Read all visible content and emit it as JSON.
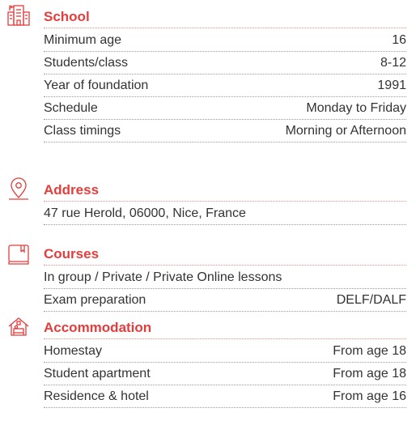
{
  "sections": [
    {
      "title": "School",
      "icon": "school-building-icon",
      "rows": [
        {
          "label": "Minimum age",
          "value": "16"
        },
        {
          "label": "Students/class",
          "value": "8-12"
        },
        {
          "label": "Year of foundation",
          "value": "1991"
        },
        {
          "label": "Schedule",
          "value": "Monday to Friday"
        },
        {
          "label": "Class timings",
          "value": "Morning or Afternoon"
        }
      ]
    },
    {
      "title": "Address",
      "icon": "map-pin-icon",
      "rows": [
        {
          "label": "47 rue Herold, 06000, Nice, France",
          "value": ""
        }
      ]
    },
    {
      "title": "Courses",
      "icon": "book-icon",
      "rows": [
        {
          "label": "In group / Private / Private Online lessons",
          "value": ""
        },
        {
          "label": "Exam preparation",
          "value": "DELF/DALF"
        }
      ]
    },
    {
      "title": "Accommodation",
      "icon": "house-bed-icon",
      "rows": [
        {
          "label": "Homestay",
          "value": "From age 18"
        },
        {
          "label": "Student apartment",
          "value": "From age 18"
        },
        {
          "label": "Residence & hotel",
          "value": "From age 16"
        }
      ]
    }
  ],
  "colors": {
    "accent": "#e53c3c",
    "text": "#333333",
    "divider": "#9a9a9a"
  }
}
